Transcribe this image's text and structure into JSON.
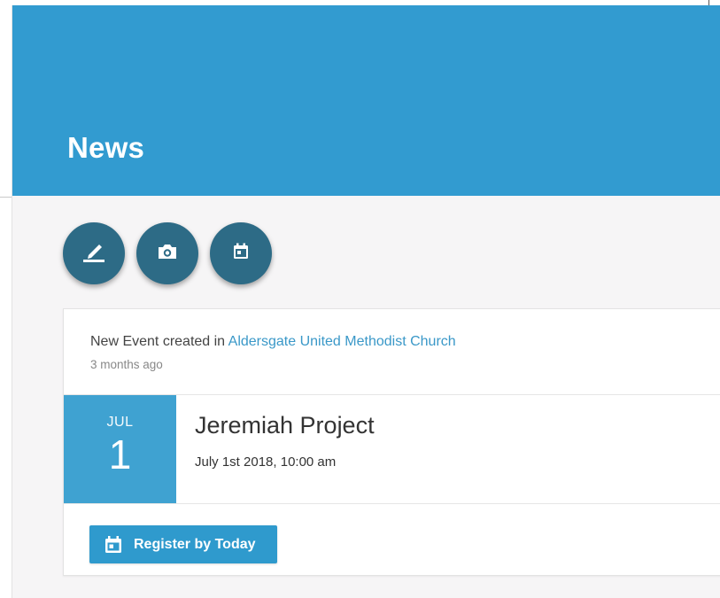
{
  "header": {
    "title": "News"
  },
  "actions": [
    {
      "icon": "pencil-icon",
      "label": ""
    },
    {
      "icon": "camera-icon",
      "label": ""
    },
    {
      "icon": "calendar-icon",
      "label": ""
    }
  ],
  "post": {
    "prefix": "New Event created in ",
    "organization": "Aldersgate United Methodist Church",
    "time_ago": "3 months ago"
  },
  "event": {
    "month": "JUL",
    "day": "1",
    "title": "Jeremiah Project",
    "datetime": "July 1st 2018, 10:00 am",
    "register_label": "Register by Today",
    "register_icon": "calendar-icon"
  },
  "colors": {
    "header_bg": "#329bd0",
    "fab_bg": "#2d6b86",
    "date_bg": "#3fa2d1",
    "link": "#3a98c8",
    "button_bg": "#2f9acd"
  }
}
